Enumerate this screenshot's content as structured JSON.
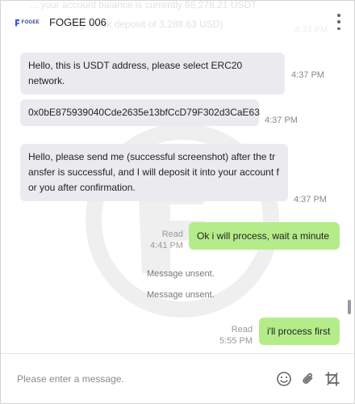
{
  "header": {
    "logo_text": "FOGEE",
    "title": "FOGEE 006",
    "menu_icon": "more-vertical-icon"
  },
  "faded_overlay": {
    "line1": "... your account balance is currently 68,278.21 USDT",
    "line2": "pay a risk deposit of 3,288.63 USD)",
    "time": "4:33 PM"
  },
  "messages": {
    "m1": {
      "text": "Hello, this is USDT address, please select ERC20 network.",
      "time": "4:37 PM"
    },
    "m2": {
      "text": "0x0bE875939040Cde2635e13bfCcD79F302d3CaE63",
      "time": "4:37 PM"
    },
    "m3": {
      "text": "Hello, please send me (successful screenshot) after the transfer is successful, and I will deposit it into your account for you after confirmation.",
      "time": "4:37 PM"
    },
    "m4": {
      "text": "Ok i will process, wait a minute",
      "status": "Read",
      "time": "4:41 PM"
    },
    "sys1": "Message unsent.",
    "sys2": "Message unsent.",
    "m5": {
      "text": "i'll process first",
      "status": "Read",
      "time": "5:55 PM"
    }
  },
  "composer": {
    "placeholder": "Please enter a message.",
    "icons": [
      "emoji-icon",
      "attachment-icon",
      "crop-icon"
    ]
  },
  "colors": {
    "incoming_bubble": "#ebebef",
    "outgoing_bubble": "#b5ec8a",
    "brand": "#3d5ad6"
  }
}
